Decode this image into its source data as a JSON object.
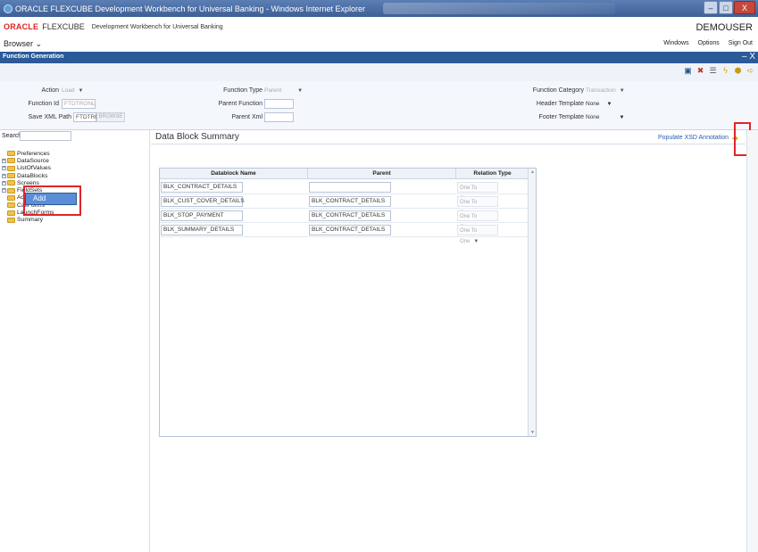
{
  "window": {
    "title": "ORACLE FLEXCUBE Development Workbench for Universal Banking - Windows Internet Explorer",
    "min": "–",
    "max": "□",
    "close": "X"
  },
  "header": {
    "oracle": "ORACLE",
    "flexcube": "FLEXCUBE",
    "workbench": "Development Workbench for Universal Banking",
    "user": "DEMOUSER"
  },
  "menu": {
    "browser": "Browser ⌄",
    "windows": "Windows",
    "options": "Options",
    "signout": "Sign Out"
  },
  "tab": {
    "title": "Function Generation",
    "close": "– X"
  },
  "toolbar": {
    "icons": [
      "save-icon",
      "delete-icon",
      "list-icon",
      "generate-icon",
      "deploy-icon",
      "exit-icon"
    ]
  },
  "form": {
    "action_label": "Action",
    "action_value": "Load",
    "function_id_label": "Function Id",
    "function_id_value": "FTDTRONL",
    "save_xml_label": "Save XML Path",
    "save_xml_value": "FTDTRONL_F",
    "browse_label": "BROWSE",
    "function_type_label": "Function Type",
    "function_type_value": "Parent",
    "parent_function_label": "Parent Function",
    "parent_function_value": "",
    "parent_xml_label": "Parent Xml",
    "parent_xml_value": "",
    "function_category_label": "Function Category",
    "function_category_value": "Transaction",
    "header_template_label": "Header Template",
    "header_template_value": "None",
    "footer_template_label": "Footer Template",
    "footer_template_value": "None"
  },
  "sidebar": {
    "search_label": "Search",
    "items": [
      {
        "label": "Preferences",
        "expandable": false
      },
      {
        "label": "DataSource",
        "expandable": true
      },
      {
        "label": "ListOfValues",
        "expandable": true
      },
      {
        "label": "DataBlocks",
        "expandable": true
      },
      {
        "label": "Screens",
        "expandable": true
      },
      {
        "label": "FieldSets",
        "expandable": true
      },
      {
        "label": "Actions",
        "expandable": false
      },
      {
        "label": "CallForms",
        "expandable": false
      },
      {
        "label": "LaunchForms",
        "expandable": false
      },
      {
        "label": "Summary",
        "expandable": false
      }
    ],
    "context_menu": "Add"
  },
  "main": {
    "title": "Data Block Summary",
    "populate_label": "Populate XSD Annotation",
    "columns": [
      "Datablock Name",
      "Parent",
      "Relation Type"
    ],
    "rows": [
      {
        "name": "BLK_CONTRACT_DETAILS",
        "parent": "",
        "relation": "One To One"
      },
      {
        "name": "BLK_CUST_COVER_DETAILS",
        "parent": "BLK_CONTRACT_DETAILS",
        "relation": "One To One"
      },
      {
        "name": "BLK_STOP_PAYMENT",
        "parent": "BLK_CONTRACT_DETAILS",
        "relation": "One To One"
      },
      {
        "name": "BLK_SUMMARY_DETAILS",
        "parent": "BLK_CONTRACT_DETAILS",
        "relation": "One To One"
      }
    ]
  }
}
